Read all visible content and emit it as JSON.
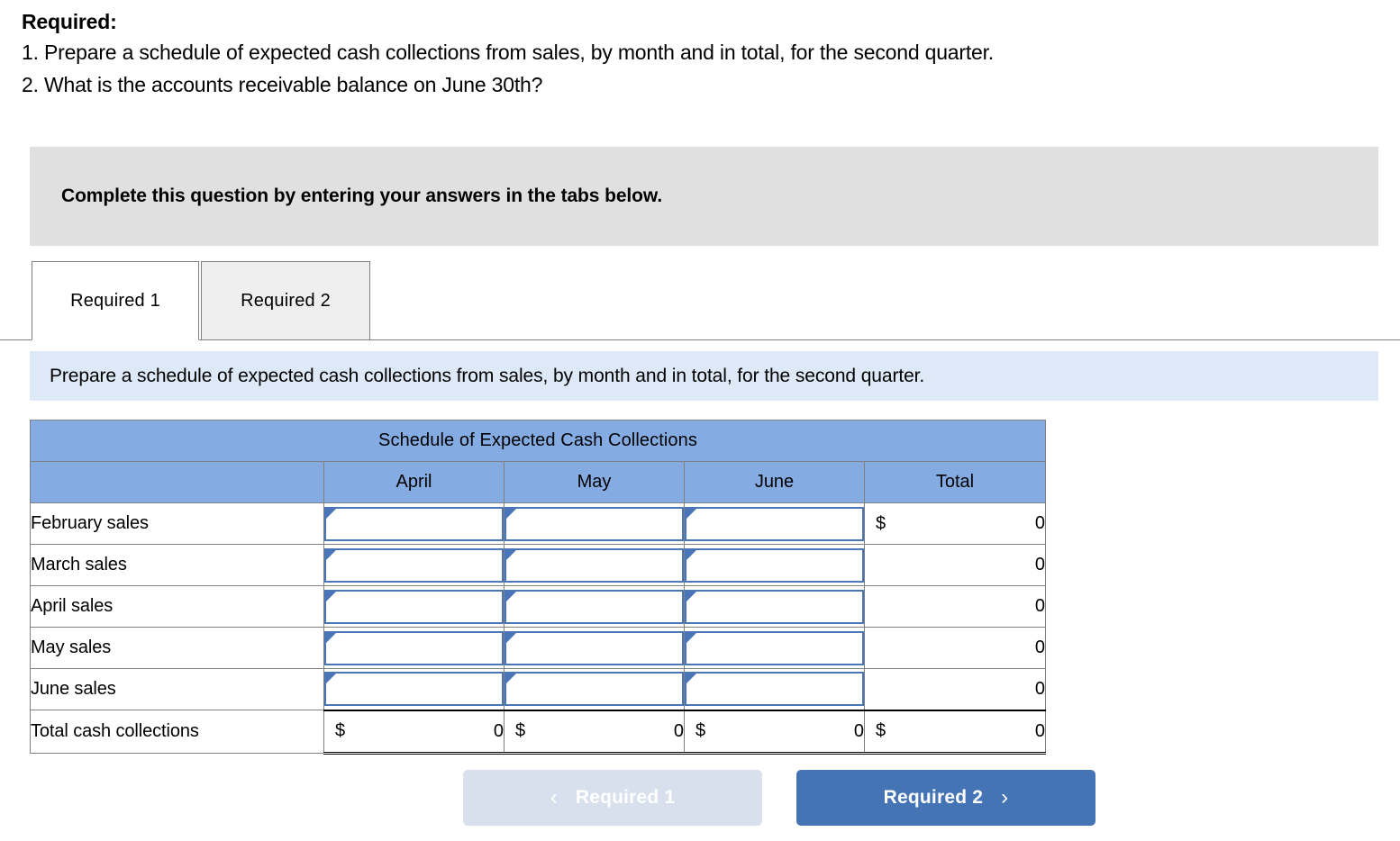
{
  "prompt": {
    "heading": "Required:",
    "items": [
      "1. Prepare a schedule of expected cash collections from sales, by month and in total, for the second quarter.",
      "2. What is the accounts receivable balance on June 30th?"
    ]
  },
  "banner": {
    "text": "Complete this question by entering your answers in the tabs below."
  },
  "tabs": [
    {
      "label": "Required 1",
      "active": true
    },
    {
      "label": "Required 2",
      "active": false
    }
  ],
  "instruction": {
    "text": "Prepare a schedule of expected cash collections from sales, by month and in total, for the second quarter."
  },
  "table": {
    "title": "Schedule of Expected Cash Collections",
    "columns": [
      "",
      "April",
      "May",
      "June",
      "Total"
    ],
    "rows": [
      {
        "label": "February sales",
        "cells": [
          "input",
          "input",
          "input"
        ],
        "total": {
          "currency": "$",
          "value": "0"
        }
      },
      {
        "label": "March sales",
        "cells": [
          "input",
          "input",
          "input"
        ],
        "total": {
          "currency": "",
          "value": "0"
        }
      },
      {
        "label": "April sales",
        "cells": [
          "input",
          "input",
          "input"
        ],
        "total": {
          "currency": "",
          "value": "0"
        }
      },
      {
        "label": "May sales",
        "cells": [
          "input",
          "input",
          "input"
        ],
        "total": {
          "currency": "",
          "value": "0"
        }
      },
      {
        "label": "June sales",
        "cells": [
          "input",
          "input",
          "input"
        ],
        "total": {
          "currency": "",
          "value": "0"
        }
      }
    ],
    "total_row": {
      "label": "Total cash collections",
      "april": {
        "currency": "$",
        "value": "0"
      },
      "may": {
        "currency": "$",
        "value": "0"
      },
      "june": {
        "currency": "$",
        "value": "0"
      },
      "total": {
        "currency": "$",
        "value": "0"
      }
    }
  },
  "nav": {
    "prev_label": "Required 1",
    "prev_chevron": "‹",
    "next_label": "Required 2",
    "next_chevron": "›"
  },
  "colors": {
    "table_header_blue": "#84ace3",
    "instruction_blue": "#dde9f7",
    "banner_gray": "#e0e0e0",
    "input_border_blue": "#4a76b8",
    "next_button_blue": "#4574b4",
    "prev_button_blue": "#d7e0ec"
  }
}
